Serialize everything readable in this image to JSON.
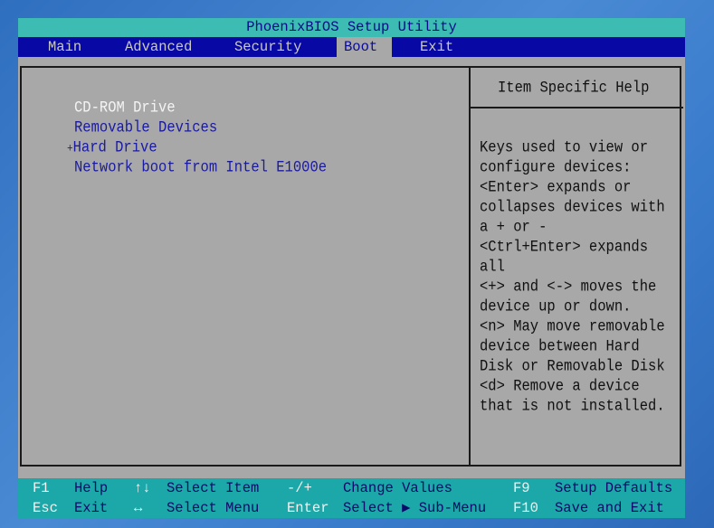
{
  "title": "PhoenixBIOS Setup Utility",
  "menu": {
    "tabs": [
      "Main",
      "Advanced",
      "Security",
      "Boot",
      "Exit"
    ],
    "active": "Boot"
  },
  "boot_order": [
    {
      "label": "CD-ROM Drive",
      "prefix": "",
      "selected": true
    },
    {
      "label": "Removable Devices",
      "prefix": "",
      "selected": false
    },
    {
      "label": "Hard Drive",
      "prefix": "+",
      "selected": false
    },
    {
      "label": "Network boot from Intel E1000e",
      "prefix": "",
      "selected": false
    }
  ],
  "help": {
    "title": "Item Specific Help",
    "lines": [
      "Keys used to view or",
      "configure devices:",
      "<Enter> expands or",
      "collapses devices with",
      "a + or -",
      "<Ctrl+Enter> expands",
      "all",
      "<+> and <-> moves the",
      "device up or down.",
      "<n> May move removable",
      "device between Hard",
      "Disk or Removable Disk",
      "<d> Remove a device",
      "that is not installed."
    ]
  },
  "footer": {
    "row1": [
      {
        "key": "F1",
        "desc": "Help"
      },
      {
        "key": "↑↓",
        "desc": "Select Item"
      },
      {
        "key": "-/+",
        "desc": "Change Values"
      },
      {
        "key": "F9",
        "desc": "Setup Defaults"
      }
    ],
    "row2": [
      {
        "key": "Esc",
        "desc": "Exit"
      },
      {
        "key": "↔",
        "desc": "Select Menu"
      },
      {
        "key": "Enter",
        "desc": "Select ▶ Sub-Menu"
      },
      {
        "key": "F10",
        "desc": "Save and Exit"
      }
    ]
  },
  "colors": {
    "title_bar": "#3dbcb4",
    "menu_bar": "#0808a4",
    "panel": "#a8a8a8",
    "footer": "#1ca8a8",
    "item_text": "#1a1aa0"
  }
}
